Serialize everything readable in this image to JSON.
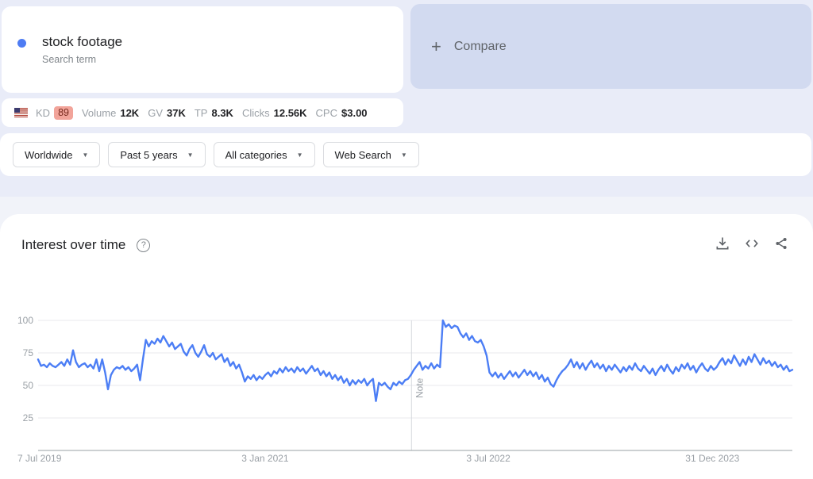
{
  "term_card": {
    "term": "stock footage",
    "subtitle": "Search term",
    "dot_color": "#4e7cf3"
  },
  "compare_card": {
    "plus": "+",
    "label": "Compare",
    "bg_color": "#d2daf0"
  },
  "metrics": {
    "flag": "us-flag",
    "badge_bg": "#f2a49a",
    "badge_text_color": "#77291d",
    "items": [
      {
        "label": "KD",
        "value": "89",
        "badge": true
      },
      {
        "label": "Volume",
        "value": "12K"
      },
      {
        "label": "GV",
        "value": "37K"
      },
      {
        "label": "TP",
        "value": "8.3K"
      },
      {
        "label": "Clicks",
        "value": "12.56K"
      },
      {
        "label": "CPC",
        "value": "$3.00"
      }
    ]
  },
  "filters": [
    {
      "label": "Worldwide"
    },
    {
      "label": "Past 5 years"
    },
    {
      "label": "All categories"
    },
    {
      "label": "Web Search"
    }
  ],
  "chart_section": {
    "title": "Interest over time",
    "help_icon": "?",
    "action_icons": [
      "download-icon",
      "embed-icon",
      "share-icon"
    ]
  },
  "chart_data": {
    "type": "line",
    "title": "Interest over time",
    "series_name": "stock footage",
    "x_unit": "week",
    "ylim": [
      0,
      100
    ],
    "yticks": [
      25,
      50,
      75,
      100
    ],
    "grid": "horizontal",
    "line_color": "#4c7ef5",
    "axis_color": "#9aa0a6",
    "grid_color": "#e8eaed",
    "xticks": [
      {
        "label": "7 Jul 2019",
        "frac": 0.0
      },
      {
        "label": "3 Jan 2021",
        "frac": 0.301
      },
      {
        "label": "3 Jul 2022",
        "frac": 0.597
      },
      {
        "label": "31 Dec 2023",
        "frac": 0.894
      }
    ],
    "note_marker": {
      "label": "Note",
      "frac": 0.495
    },
    "values": [
      70,
      65,
      66,
      64,
      67,
      65,
      64,
      66,
      68,
      65,
      70,
      66,
      77,
      68,
      64,
      66,
      67,
      64,
      66,
      63,
      70,
      61,
      70,
      60,
      47,
      58,
      62,
      64,
      63,
      65,
      62,
      64,
      61,
      63,
      66,
      54,
      70,
      85,
      80,
      84,
      82,
      86,
      83,
      88,
      84,
      80,
      83,
      78,
      80,
      82,
      76,
      73,
      78,
      81,
      75,
      72,
      76,
      81,
      74,
      72,
      75,
      70,
      72,
      74,
      68,
      71,
      65,
      68,
      63,
      66,
      60,
      53,
      57,
      55,
      58,
      54,
      57,
      55,
      58,
      60,
      57,
      61,
      59,
      63,
      60,
      64,
      61,
      63,
      60,
      64,
      61,
      63,
      59,
      62,
      65,
      61,
      63,
      58,
      61,
      57,
      60,
      55,
      58,
      54,
      57,
      52,
      55,
      50,
      54,
      51,
      54,
      52,
      55,
      50,
      53,
      55,
      38,
      52,
      50,
      52,
      49,
      47,
      52,
      50,
      53,
      51,
      54,
      55,
      58,
      62,
      65,
      68,
      62,
      65,
      63,
      67,
      63,
      66,
      64,
      100,
      95,
      97,
      94,
      96,
      95,
      90,
      87,
      90,
      85,
      88,
      84,
      83,
      85,
      80,
      73,
      60,
      57,
      60,
      56,
      59,
      55,
      58,
      61,
      57,
      60,
      56,
      59,
      62,
      58,
      61,
      57,
      60,
      55,
      58,
      53,
      56,
      51,
      49,
      54,
      58,
      61,
      63,
      66,
      70,
      64,
      68,
      63,
      67,
      62,
      66,
      69,
      64,
      67,
      63,
      66,
      61,
      65,
      62,
      66,
      63,
      60,
      64,
      61,
      65,
      62,
      67,
      63,
      61,
      65,
      62,
      59,
      63,
      58,
      62,
      65,
      61,
      66,
      62,
      59,
      64,
      61,
      66,
      63,
      67,
      62,
      65,
      60,
      64,
      67,
      63,
      61,
      65,
      62,
      64,
      68,
      71,
      66,
      70,
      67,
      73,
      69,
      65,
      70,
      66,
      72,
      68,
      74,
      70,
      66,
      71,
      67,
      69,
      65,
      68,
      64,
      66,
      62,
      65,
      61,
      62
    ]
  }
}
